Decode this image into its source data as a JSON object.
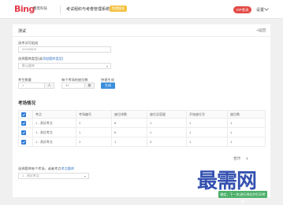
{
  "topbar": {
    "logo_text": "Bing",
    "logo_sub": "鑫借科技",
    "title": "考试组织与考卷管理系统 V3",
    "badge": "免费版本",
    "vip_label": "VIP会员",
    "settings_label": "设置"
  },
  "card": {
    "title": "测试",
    "return_link": "<返回"
  },
  "form": {
    "exam_id_label": "选考试可组成",
    "exam_id_value": "20190509",
    "question_bank_label": "选择题库类型(或",
    "question_bank_link": "添加题库类型)",
    "question_bank_value": "默认题库",
    "count_label": "考生数量",
    "count_value": "1",
    "count_unit": "人",
    "per_exam_label": "每个考场的座位数",
    "per_exam_value": "30",
    "per_exam_unit": "座",
    "generate_label": "快速生成",
    "generate_button": "生成"
  },
  "section": {
    "title": "考场情况"
  },
  "table": {
    "headers": [
      "",
      "考点",
      "考场编号",
      "座位排数",
      "座位总容量",
      "开始座位号",
      "座位数"
    ],
    "rows": [
      {
        "name": "1 - 测试考点",
        "c1": "1",
        "c2": "8",
        "c3": "1",
        "c4": "1",
        "c5": "1"
      },
      {
        "name": "1 - 测试考点",
        "c1": "1",
        "c2": "6",
        "c3": "1",
        "c4": "1",
        "c5": "1"
      },
      {
        "name": "1 - 测试考点",
        "c1": "1",
        "c2": "1",
        "c3": "3",
        "c4": "1",
        "c5": "1"
      }
    ],
    "total_label": "合计:",
    "total_value": "1"
  },
  "bottom": {
    "label": "选择题库每个考场，或者考点",
    "link": "考点题库",
    "select_value": "1 - 测试考点"
  },
  "footer": {
    "button": "确定，下一步(进行排位并打印考场)"
  },
  "watermark": {
    "text": "最需网"
  },
  "colors": {
    "brand": "#e23c4b",
    "primary": "#3b8fdc",
    "success": "#4cb06a",
    "badge": "#f5c342"
  }
}
